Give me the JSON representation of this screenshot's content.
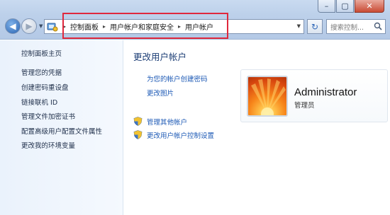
{
  "window": {
    "minimize_glyph": "–",
    "maximize_glyph": "▢",
    "close_glyph": "✕"
  },
  "nav": {
    "back_glyph": "◀",
    "forward_glyph": "▶",
    "history_glyph": "▼",
    "refresh_glyph": "↻"
  },
  "address": {
    "breadcrumb": [
      "控制面板",
      "用户帐户和家庭安全",
      "用户帐户"
    ],
    "separator": "▸",
    "dropdown_glyph": "▼"
  },
  "search": {
    "placeholder": "搜索控制..."
  },
  "sidebar": {
    "items": [
      {
        "label": "控制面板主页"
      },
      {
        "label": "管理您的凭据"
      },
      {
        "label": "创建密码重设盘"
      },
      {
        "label": "链接联机 ID"
      },
      {
        "label": "管理文件加密证书"
      },
      {
        "label": "配置高级用户配置文件属性"
      },
      {
        "label": "更改我的环境变量"
      }
    ]
  },
  "main": {
    "title": "更改用户帐户",
    "links": [
      {
        "label": "为您的帐户创建密码"
      },
      {
        "label": "更改图片"
      }
    ],
    "admin_links": [
      {
        "label": "管理其他帐户"
      },
      {
        "label": "更改用户帐户控制设置"
      }
    ]
  },
  "account": {
    "name": "Administrator",
    "role": "管理员"
  },
  "colors": {
    "highlight_border": "#e0283d",
    "link": "#1c59b5",
    "title": "#1d3e76"
  },
  "icons": [
    "back-icon",
    "forward-icon",
    "control-panel-icon",
    "refresh-icon",
    "search-icon",
    "shield-icon",
    "flower-avatar"
  ]
}
